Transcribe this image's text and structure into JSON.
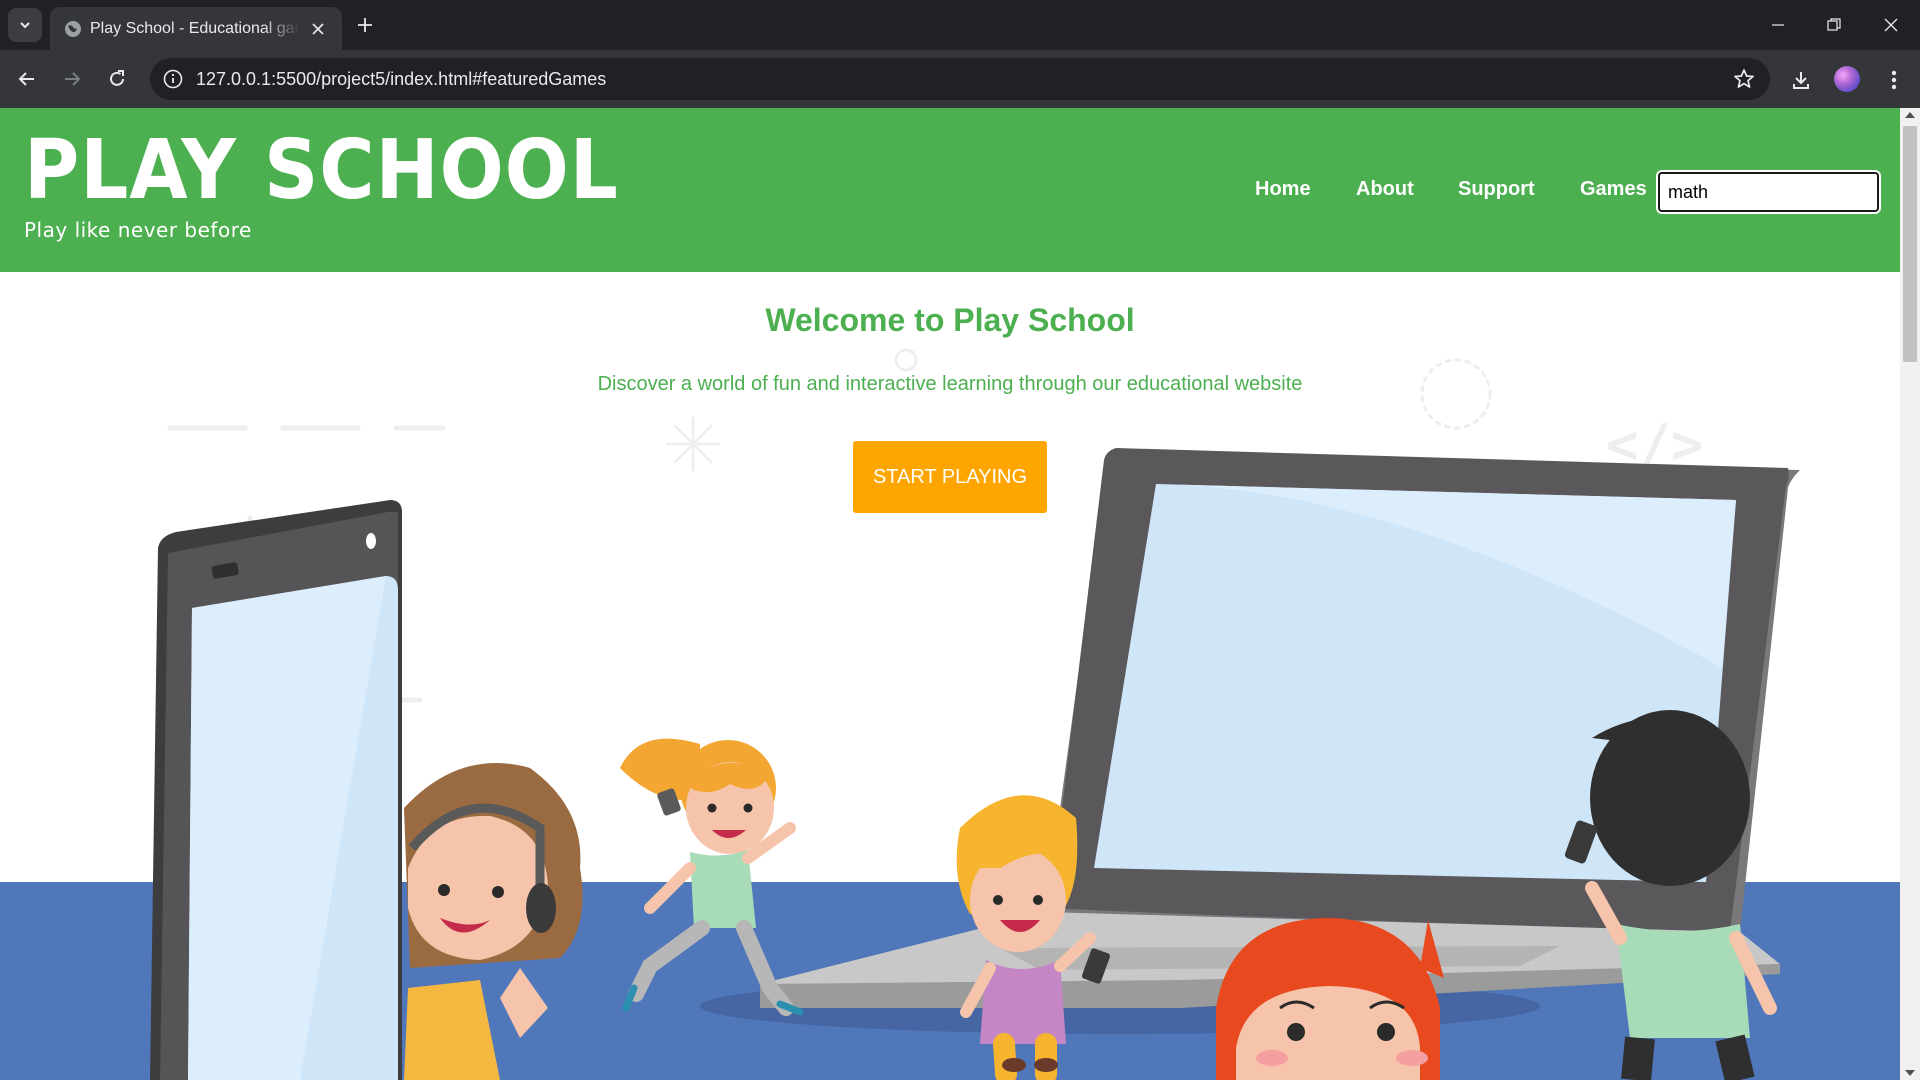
{
  "browser": {
    "tab_title": "Play School - Educational games",
    "url": "127.0.0.1:5500/project5/index.html#featuredGames"
  },
  "header": {
    "logo": "PLAY SCHOOL",
    "tagline": "Play like never before",
    "nav": [
      "Home",
      "About",
      "Support",
      "Games"
    ],
    "search_value": "math"
  },
  "hero": {
    "title": "Welcome to Play School",
    "subtitle": "Discover a world of fun and interactive learning through our educational website",
    "cta_label": "START PLAYING",
    "illustration_code_symbol": "</>"
  },
  "colors": {
    "header_green": "#4caf50",
    "cta_orange": "#ffa500",
    "floor_blue": "#5077ba"
  }
}
